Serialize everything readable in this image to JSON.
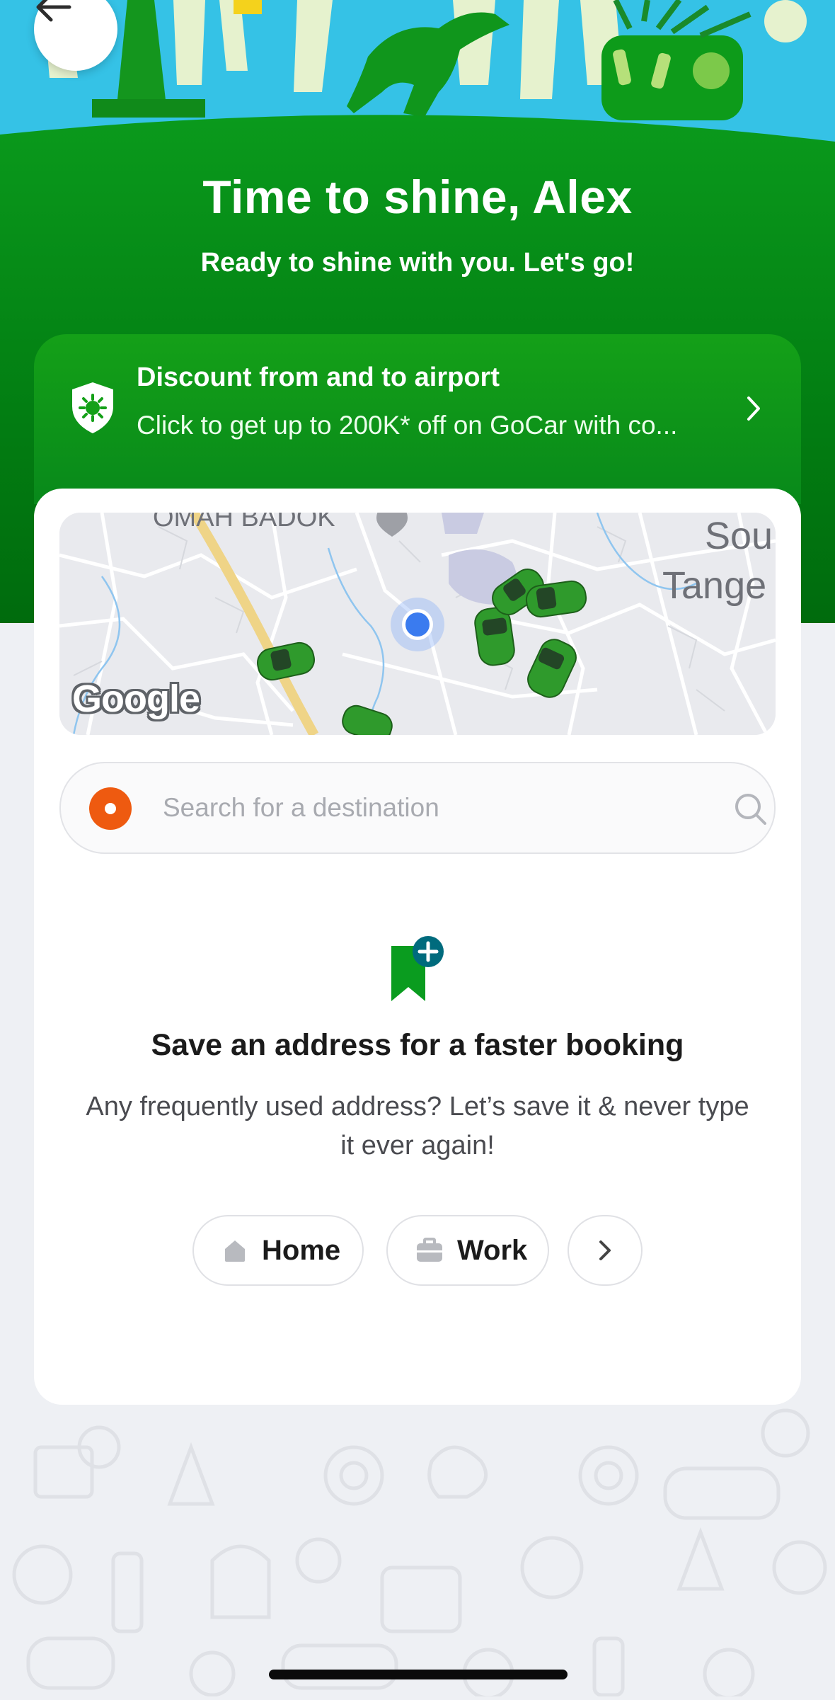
{
  "hero": {
    "title": "Time to shine, Alex",
    "subtitle": "Ready to shine with you. Let's go!"
  },
  "promo": {
    "title": "Discount from and to airport",
    "description": "Click to get up to 200K* off on GoCar with co..."
  },
  "map": {
    "labels": [
      "OMAH BADOK",
      "Sou",
      "Tange"
    ],
    "attribution": "Google"
  },
  "search": {
    "placeholder": "Search for a destination"
  },
  "saved_address": {
    "title": "Save an address for a faster booking",
    "description": "Any frequently used address? Let’s save it & never type it ever again!",
    "chips": [
      {
        "label": "Home",
        "icon": "house-icon"
      },
      {
        "label": "Work",
        "icon": "briefcase-icon"
      }
    ]
  },
  "colors": {
    "brand_green": "#00880f",
    "promo_green": "#14a018",
    "sky_blue": "#35c2e6",
    "search_dot": "#ee5a10",
    "save_icon_teal": "#006b7d"
  },
  "icons": [
    "back-arrow-icon",
    "shield-virus-icon",
    "chevron-right-icon",
    "location-dot-icon",
    "search-icon",
    "bookmark-plus-icon",
    "house-icon",
    "briefcase-icon"
  ]
}
